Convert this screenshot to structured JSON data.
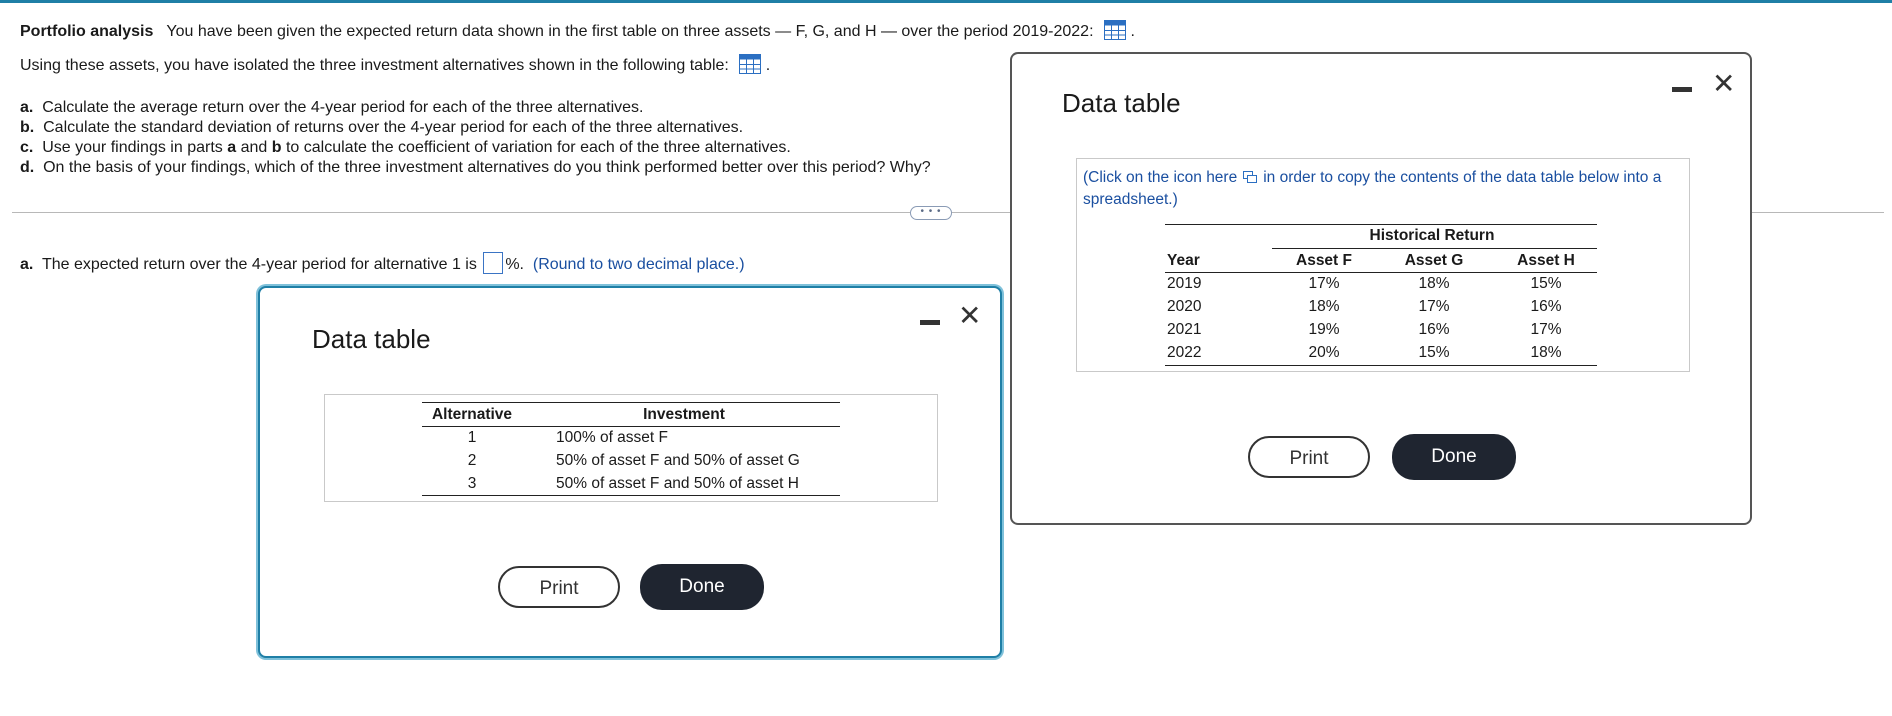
{
  "header": {
    "title": "Portfolio analysis",
    "intro": "You have been given the expected return data shown in the first table on three assets — F, G, and H — over the period 2019-2022:",
    "line2": "Using these assets, you have isolated the three investment alternatives shown in the following table:"
  },
  "questions": [
    {
      "letter": "a.",
      "text": "Calculate the average return over the 4-year period for each of the three alternatives."
    },
    {
      "letter": "b.",
      "text": "Calculate the standard deviation of returns over the 4-year period for each of the three alternatives."
    },
    {
      "letter": "c.",
      "text_before": "Use your findings in parts",
      "a": "a",
      "and": "and",
      "b": "b",
      "text_after": "to calculate the coefficient of variation for each of the three alternatives."
    },
    {
      "letter": "d.",
      "text": "On the basis of your findings, which of the three investment alternatives do you think performed better over this period?  Why?"
    }
  ],
  "more_button": "• • •",
  "answer": {
    "letter": "a.",
    "text_before": "The expected return over the 4-year period for alternative 1 is",
    "unit": "%.",
    "hint": "(Round to two decimal place.)"
  },
  "dialog_returns": {
    "title": "Data table",
    "copy_note_before": "(Click on the icon here",
    "copy_note_after": "in order to copy the contents of the data table below into a spreadsheet.)",
    "group_header": "Historical Return",
    "columns": [
      "Year",
      "Asset F",
      "Asset G",
      "Asset H"
    ],
    "rows": [
      [
        "2019",
        "17%",
        "18%",
        "15%"
      ],
      [
        "2020",
        "18%",
        "17%",
        "16%"
      ],
      [
        "2021",
        "19%",
        "16%",
        "17%"
      ],
      [
        "2022",
        "20%",
        "15%",
        "18%"
      ]
    ],
    "print_label": "Print",
    "done_label": "Done"
  },
  "dialog_alternatives": {
    "title": "Data table",
    "columns": [
      "Alternative",
      "Investment"
    ],
    "rows": [
      [
        "1",
        "100% of asset F"
      ],
      [
        "2",
        "50% of asset F and 50% of asset G"
      ],
      [
        "3",
        "50% of asset F and 50% of asset H"
      ]
    ],
    "print_label": "Print",
    "done_label": "Done"
  }
}
